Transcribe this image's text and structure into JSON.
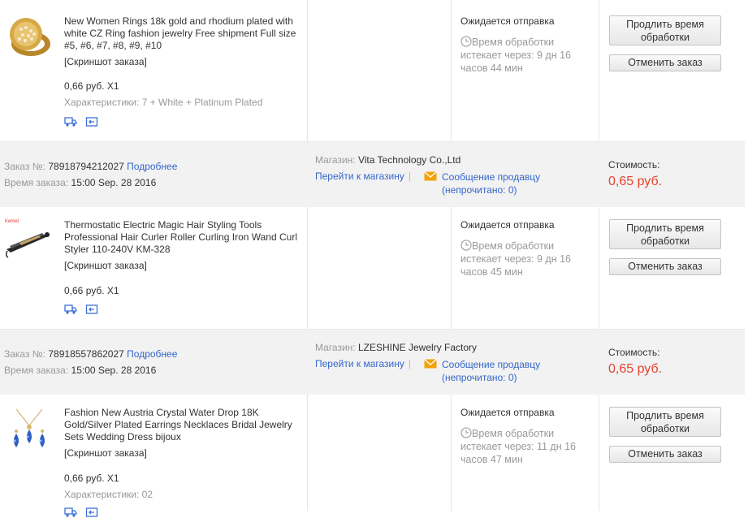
{
  "labels": {
    "order_no": "Заказ №:",
    "details": "Подробнее",
    "order_time": "Время заказа:",
    "store": "Магазин:",
    "go_to_store": "Перейти к магазину",
    "message_seller": "Сообщение продавцу",
    "unread_open": "(непрочитано: ",
    "unread_close": ")",
    "cost": "Стоимость:",
    "status": "Ожидается отправка",
    "processing": "Время обработки",
    "extend_button": "Продлить время обработки",
    "cancel_button": "Отменить заказ",
    "screenshot": "[Скриншот заказа]"
  },
  "items": [
    {
      "title": "New Women Rings 18k gold and rhodium plated with white CZ Ring fashion jewelry Free shipment Full size #5, #6, #7, #8, #9, #10",
      "price": "0,66 руб. X1",
      "props": "Характеристики: 7 + White + Platinum Plated",
      "expires": "истекает через: 9 дн 16 часов 44 мин"
    },
    {
      "title": "Thermostatic Electric Magic Hair Styling Tools Professional Hair Curler Roller Curling Iron Wand Curl Styler 110-240V KM-328",
      "price": "0,66 руб. X1",
      "props": "",
      "expires": "истекает через: 9 дн 16 часов 45 мин"
    },
    {
      "title": "Fashion New Austria Crystal Water Drop 18K Gold/Silver Plated Earrings Necklaces Bridal Jewelry Sets Wedding Dress bijoux",
      "price": "0,66 руб. X1",
      "props": "Характеристики: 02",
      "expires": "истекает через: 11 дн 16 часов 47 мин"
    }
  ],
  "orders": [
    {
      "number": "78918794212027",
      "time": "15:00 Sep. 28 2016",
      "store": "Vita Technology Co.,Ltd",
      "unread": "0",
      "cost": "0,65 руб."
    },
    {
      "number": "78918557862027",
      "time": "15:00 Sep. 28 2016",
      "store": "LZESHINE Jewelry Factory",
      "unread": "0",
      "cost": "0,65 руб."
    }
  ],
  "colors": {
    "link": "#3366cc",
    "cost": "#e6432f",
    "header_bg": "#f2f2f2",
    "mail_icon": "#f0a30a",
    "mini_icon": "#3b6fd6"
  },
  "icons": [
    "ring-thumbnail",
    "hair-curler-thumbnail",
    "earrings-thumbnail",
    "shipping-icon",
    "return-icon",
    "clock-icon",
    "mail-icon"
  ]
}
